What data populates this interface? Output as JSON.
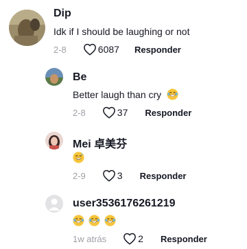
{
  "comments": [
    {
      "username": "Dip",
      "text": "Idk if I should be laughing or not",
      "date": "2-8",
      "likes": "6087",
      "reply_label": "Responder"
    },
    {
      "username": "Be",
      "text": "Better laugh than cry",
      "date": "2-8",
      "likes": "37",
      "reply_label": "Responder"
    },
    {
      "username": "Mei 卓美芬",
      "text": "",
      "date": "2-9",
      "likes": "3",
      "reply_label": "Responder"
    },
    {
      "username": "user3536176261219",
      "text": "",
      "date": "1w atrás",
      "likes": "2",
      "reply_label": "Responder"
    }
  ],
  "icons": {
    "like": "heart-outline-icon",
    "emoji_tears_of_joy": "face-with-tears-of-joy-icon",
    "emoji_grin_sweat": "grinning-face-with-sweat-icon"
  },
  "colors": {
    "text": "#161823",
    "meta": "#a0a0a8",
    "emoji_face": "#f7c53b"
  }
}
